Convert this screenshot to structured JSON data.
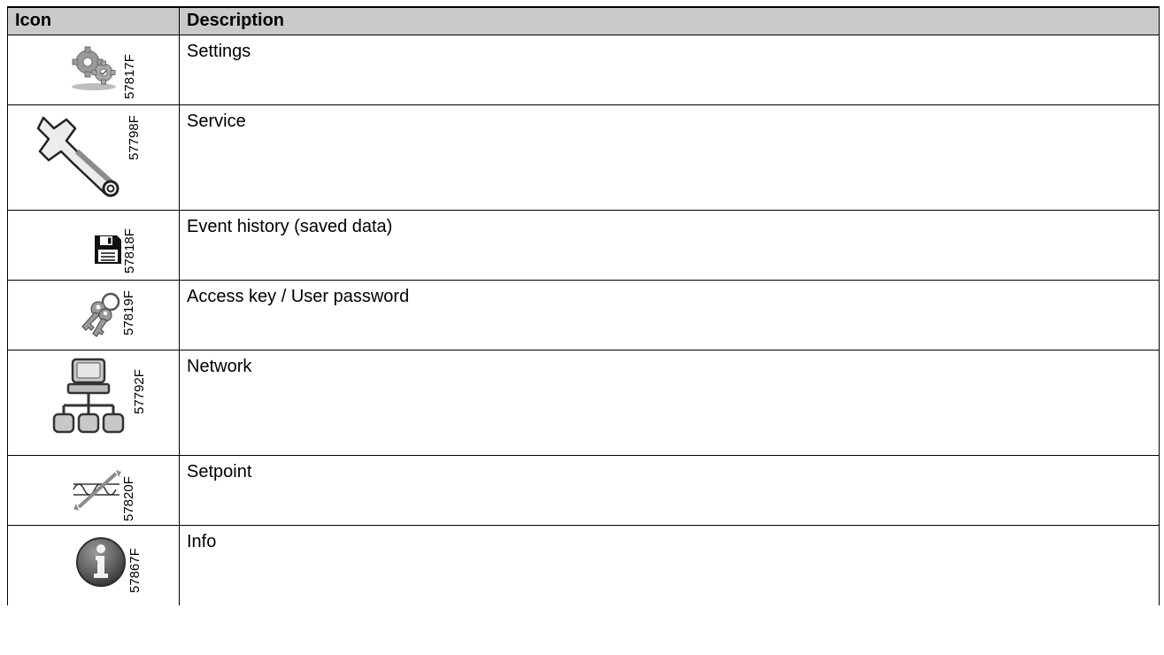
{
  "table": {
    "header": {
      "icon": "Icon",
      "description": "Description"
    },
    "rows": [
      {
        "icon": "gears-icon",
        "code": "57817F",
        "description": "Settings"
      },
      {
        "icon": "wrench-icon",
        "code": "57798F",
        "description": "Service"
      },
      {
        "icon": "floppy-disk-icon",
        "code": "57818F",
        "description": "Event history (saved data)"
      },
      {
        "icon": "keys-icon",
        "code": "57819F",
        "description": "Access key / User password"
      },
      {
        "icon": "network-icon",
        "code": "57792F",
        "description": "Network"
      },
      {
        "icon": "setpoint-icon",
        "code": "57820F",
        "description": "Setpoint"
      },
      {
        "icon": "info-icon",
        "code": "57867F",
        "description": "Info"
      }
    ]
  },
  "colors": {
    "header_background": "#c9c9c9",
    "border": "#000000",
    "icon_gray": "#8c8c8c"
  }
}
